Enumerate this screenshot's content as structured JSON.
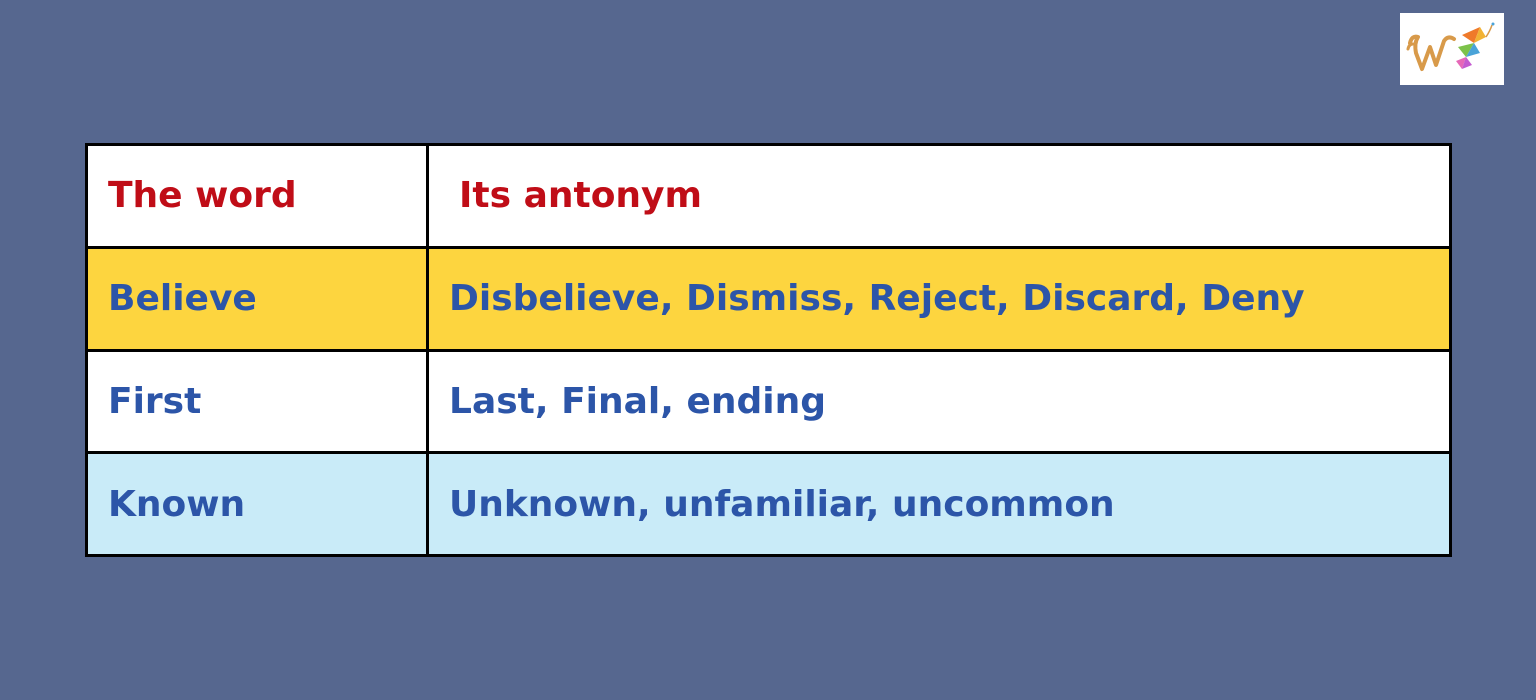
{
  "logo": {
    "icon": "w-kite-logo"
  },
  "table": {
    "header": {
      "word": "The word",
      "antonym": "Its antonym"
    },
    "rows": [
      {
        "word": "Believe",
        "antonyms": "Disbelieve, Dismiss, Reject, Discard, Deny",
        "background": "#fdd53f"
      },
      {
        "word": "First",
        "antonyms": "Last, Final, ending",
        "background": "#ffffff"
      },
      {
        "word": "Known",
        "antonyms": "Unknown, unfamiliar, uncommon",
        "background": "#c9ebf8"
      }
    ]
  },
  "colors": {
    "page_background": "#56678f",
    "header_text": "#c00d17",
    "body_text": "#2c55a8",
    "border": "#000000"
  }
}
